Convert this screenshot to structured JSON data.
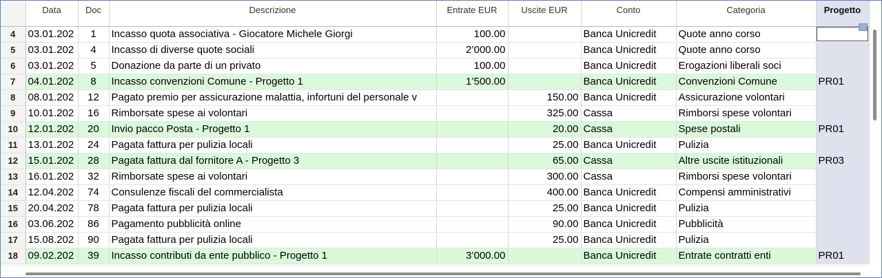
{
  "columns": {
    "date": "Data",
    "doc": "Doc",
    "description": "Descrizione",
    "income": "Entrate EUR",
    "expense": "Uscite EUR",
    "account": "Conto",
    "category": "Categoria",
    "project": "Progetto"
  },
  "rows": [
    {
      "n": "4",
      "date": "03.01.202",
      "doc": "1",
      "desc": "Incasso quota associativa - Giocatore Michele Giorgi",
      "in": "100.00",
      "out": "",
      "account": "Banca Unicredit",
      "category": "Quote anno corso",
      "project": "",
      "green": false,
      "selected": true
    },
    {
      "n": "5",
      "date": "03.01.202",
      "doc": "4",
      "desc": "Incasso di diverse quote sociali",
      "in": "2’000.00",
      "out": "",
      "account": "Banca Unicredit",
      "category": "Quote anno corso",
      "project": "",
      "green": false
    },
    {
      "n": "6",
      "date": "03.01.202",
      "doc": "5",
      "desc": "Donazione da parte di un privato",
      "in": "100.00",
      "out": "",
      "account": "Banca Unicredit",
      "category": "Erogazioni liberali soci",
      "project": "",
      "green": false
    },
    {
      "n": "7",
      "date": "04.01.202",
      "doc": "8",
      "desc": "Incasso convenzioni Comune - Progetto 1",
      "in": "1’500.00",
      "out": "",
      "account": "Banca Unicredit",
      "category": "Convenzioni Comune",
      "project": "PR01",
      "green": true
    },
    {
      "n": "8",
      "date": "08.01.202",
      "doc": "12",
      "desc": "Pagato premio per assicurazione malattia, infortuni del personale v",
      "in": "",
      "out": "150.00",
      "account": "Banca Unicredit",
      "category": "Assicurazione volontari",
      "project": "",
      "green": false
    },
    {
      "n": "9",
      "date": "10.01.202",
      "doc": "16",
      "desc": "Rimborsate spese ai volontari",
      "in": "",
      "out": "325.00",
      "account": "Cassa",
      "category": "Rimborsi spese volontari",
      "project": "",
      "green": false
    },
    {
      "n": "10",
      "date": "12.01.202",
      "doc": "20",
      "desc": "Invio pacco Posta - Progetto 1",
      "in": "",
      "out": "20.00",
      "account": "Cassa",
      "category": "Spese postali",
      "project": "PR01",
      "green": true
    },
    {
      "n": "11",
      "date": "13.01.202",
      "doc": "24",
      "desc": "Pagata fattura per pulizia locali",
      "in": "",
      "out": "25.00",
      "account": "Banca Unicredit",
      "category": "Pulizia",
      "project": "",
      "green": false
    },
    {
      "n": "12",
      "date": "15.01.202",
      "doc": "28",
      "desc": "Pagata fattura dal fornitore A - Progetto 3",
      "in": "",
      "out": "65.00",
      "account": "Cassa",
      "category": "Altre uscite istituzionali",
      "project": "PR03",
      "green": true
    },
    {
      "n": "13",
      "date": "16.01.202",
      "doc": "32",
      "desc": "Rimborsate spese ai volontari",
      "in": "",
      "out": "300.00",
      "account": "Cassa",
      "category": "Rimborsi spese volontari",
      "project": "",
      "green": false
    },
    {
      "n": "14",
      "date": "12.04.202",
      "doc": "74",
      "desc": "Consulenze fiscali del commercialista",
      "in": "",
      "out": "400.00",
      "account": "Banca Unicredit",
      "category": "Compensi amministrativi",
      "project": "",
      "green": false
    },
    {
      "n": "15",
      "date": "20.04.202",
      "doc": "78",
      "desc": "Pagata fattura per pulizia locali",
      "in": "",
      "out": "25.00",
      "account": "Banca Unicredit",
      "category": "Pulizia",
      "project": "",
      "green": false
    },
    {
      "n": "16",
      "date": "03.06.202",
      "doc": "86",
      "desc": "Pagamento pubblicità online",
      "in": "",
      "out": "90.00",
      "account": "Banca Unicredit",
      "category": "Pubblicità",
      "project": "",
      "green": false
    },
    {
      "n": "17",
      "date": "15.08.202",
      "doc": "90",
      "desc": "Pagata fattura per pulizia locali",
      "in": "",
      "out": "25.00",
      "account": "Banca Unicredit",
      "category": "Pulizia",
      "project": "",
      "green": false
    },
    {
      "n": "18",
      "date": "09.02.202",
      "doc": "39",
      "desc": "Incasso contributi da ente pubblico - Progetto 1",
      "in": "3’000.00",
      "out": "",
      "account": "Banca Unicredit",
      "category": "Entrate contratti enti",
      "project": "PR01",
      "green": true
    }
  ]
}
